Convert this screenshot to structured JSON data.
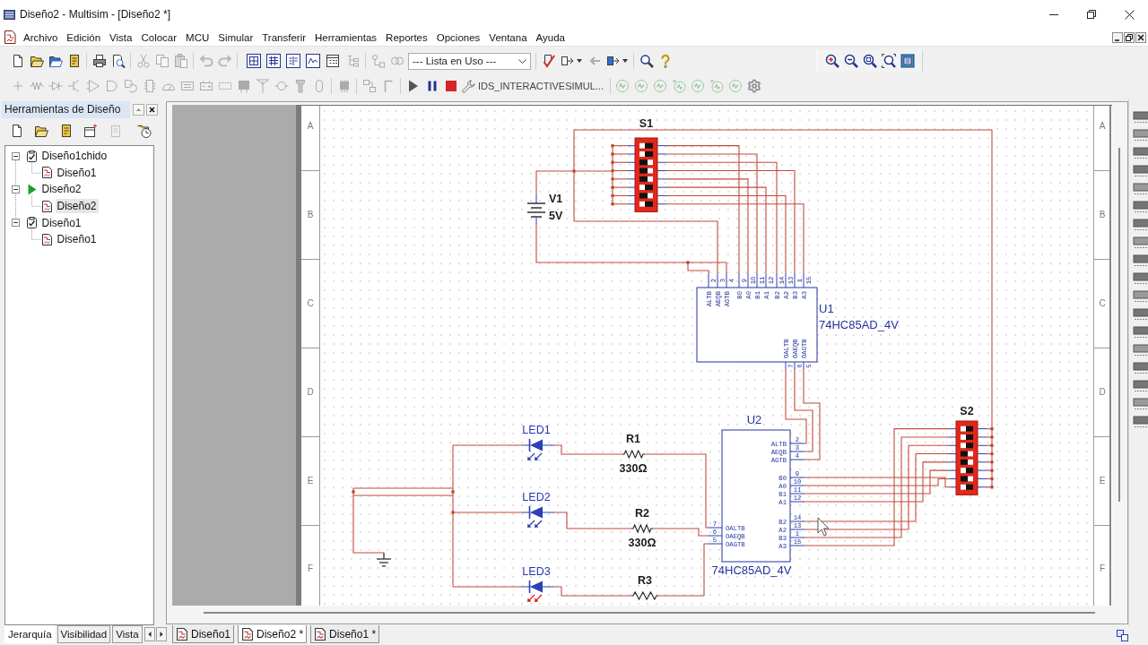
{
  "window": {
    "title": "Diseño2 - Multisim - [Diseño2 *]"
  },
  "menu": [
    "Archivo",
    "Edición",
    "Vista",
    "Colocar",
    "MCU",
    "Simular",
    "Transferir",
    "Herramientas",
    "Reportes",
    "Opciones",
    "Ventana",
    "Ayuda"
  ],
  "toolbar_groups": [
    {
      "kind": "file",
      "disabled": false
    },
    {
      "kind": "edit",
      "disabled": true
    },
    {
      "kind": "history",
      "disabled": true
    },
    {
      "kind": "components",
      "disabled": true
    },
    {
      "kind": "instruments",
      "disabled": true
    }
  ],
  "component_list": {
    "value": "--- Lista en Uso ---"
  },
  "simulation": {
    "label": "IDS_INTERACTIVESIMUL..."
  },
  "design_toolbox": {
    "title": "Herramientas de Diseño",
    "tree": [
      {
        "label": "Diseño1chido",
        "kind": "project",
        "active": false,
        "expanded": true,
        "selected": false,
        "children": [
          {
            "label": "Diseño1",
            "kind": "sheet",
            "selected": false
          }
        ]
      },
      {
        "label": "Diseño2",
        "kind": "project",
        "active": true,
        "expanded": true,
        "selected": false,
        "children": [
          {
            "label": "Diseño2",
            "kind": "sheet",
            "selected": true
          }
        ]
      },
      {
        "label": "Diseño1",
        "kind": "project",
        "active": false,
        "expanded": true,
        "selected": false,
        "children": [
          {
            "label": "Diseño1",
            "kind": "sheet",
            "selected": false
          }
        ]
      }
    ],
    "tabs": [
      {
        "label": "Jerarquía",
        "selected": true
      },
      {
        "label": "Visibilidad",
        "selected": false
      },
      {
        "label": "Vista",
        "selected": false
      }
    ]
  },
  "sheet": {
    "zones_left": [
      "A",
      "B",
      "C",
      "D",
      "E",
      "F"
    ],
    "zones_right": [
      "A",
      "B",
      "C",
      "D",
      "E",
      "F"
    ],
    "components": [
      {
        "kind": "dip_switch",
        "ref": "S1",
        "switches": [
          {
            "on": false
          },
          {
            "on": false
          },
          {
            "on": true
          },
          {
            "on": true
          },
          {
            "on": true
          },
          {
            "on": false
          },
          {
            "on": true
          },
          {
            "on": false
          }
        ]
      },
      {
        "kind": "battery",
        "ref": "V1",
        "value": "5V"
      },
      {
        "kind": "comparator",
        "ref": "U1",
        "part": "74HC85AD_4V",
        "inputs": [
          {
            "name": "ALTB",
            "pin": "2"
          },
          {
            "name": "AEQB",
            "pin": "3"
          },
          {
            "name": "AGTB",
            "pin": "4"
          },
          {
            "name": "B0",
            "pin": "9"
          },
          {
            "name": "A0",
            "pin": "10"
          },
          {
            "name": "B1",
            "pin": "11"
          },
          {
            "name": "A1",
            "pin": "12"
          },
          {
            "name": "B2",
            "pin": "14"
          },
          {
            "name": "A2",
            "pin": "13"
          },
          {
            "name": "B3",
            "pin": "1"
          },
          {
            "name": "A3",
            "pin": "15"
          }
        ],
        "outputs": [
          {
            "name": "OALTB",
            "pin": "7"
          },
          {
            "name": "OAEQB",
            "pin": "6"
          },
          {
            "name": "OAGTB",
            "pin": "5"
          }
        ]
      },
      {
        "kind": "dip_switch",
        "ref": "S2",
        "switches": [
          {
            "on": false
          },
          {
            "on": false
          },
          {
            "on": false
          },
          {
            "on": true
          },
          {
            "on": true
          },
          {
            "on": false
          },
          {
            "on": true
          },
          {
            "on": false
          }
        ]
      },
      {
        "kind": "comparator",
        "ref": "U2",
        "part": "74HC85AD_4V",
        "inputs": [
          {
            "name": "ALTB",
            "pin": "2"
          },
          {
            "name": "AEQB",
            "pin": "3"
          },
          {
            "name": "AGTB",
            "pin": "4"
          },
          {
            "name": "B0",
            "pin": "9"
          },
          {
            "name": "A0",
            "pin": "10"
          },
          {
            "name": "B1",
            "pin": "11"
          },
          {
            "name": "A1",
            "pin": "12"
          },
          {
            "name": "B2",
            "pin": "14"
          },
          {
            "name": "A2",
            "pin": "13"
          },
          {
            "name": "B3",
            "pin": "1"
          },
          {
            "name": "A3",
            "pin": "15"
          }
        ],
        "outputs": [
          {
            "name": "OALTB",
            "pin": "7"
          },
          {
            "name": "OAEQB",
            "pin": "6"
          },
          {
            "name": "OAGTB",
            "pin": "5"
          }
        ]
      },
      {
        "kind": "led",
        "ref": "LED1",
        "lit": false
      },
      {
        "kind": "resistor",
        "ref": "R1",
        "value": "330Ω"
      },
      {
        "kind": "led",
        "ref": "LED2",
        "lit": false
      },
      {
        "kind": "resistor",
        "ref": "R2",
        "value": "330Ω"
      },
      {
        "kind": "led",
        "ref": "LED3",
        "lit": true
      },
      {
        "kind": "resistor",
        "ref": "R3"
      },
      {
        "kind": "ground"
      }
    ]
  },
  "document_tabs": [
    {
      "label": "Diseño1",
      "selected": false
    },
    {
      "label": "Diseño2 *",
      "selected": true
    },
    {
      "label": "Diseño1 *",
      "selected": false
    }
  ]
}
